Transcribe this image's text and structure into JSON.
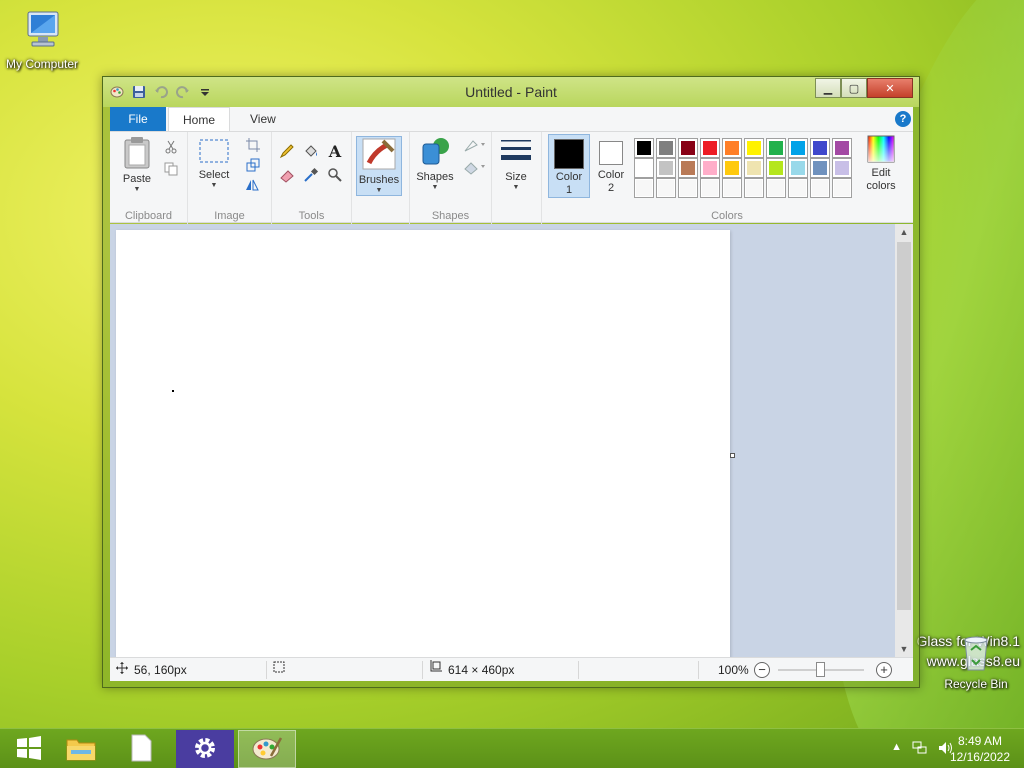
{
  "desktop": {
    "icons": [
      {
        "label": "My Computer",
        "icon": "computer-icon"
      },
      {
        "label": "Recycle Bin",
        "icon": "recycle-bin-icon"
      }
    ],
    "watermark_line1": "Glass for Win8.1",
    "watermark_line2": "www.glass8.eu"
  },
  "window": {
    "title": "Untitled - Paint",
    "controls": {
      "minimize": "minimize-icon",
      "maximize": "maximize-icon",
      "close": "close-icon"
    }
  },
  "tabs": {
    "file": "File",
    "home": "Home",
    "view": "View",
    "help": "?"
  },
  "ribbon": {
    "clipboard": {
      "label": "Clipboard",
      "paste": "Paste"
    },
    "image": {
      "label": "Image",
      "select": "Select"
    },
    "tools": {
      "label": "Tools"
    },
    "brushes": {
      "label": "Brushes"
    },
    "shapes": {
      "label": "Shapes",
      "button": "Shapes"
    },
    "size": {
      "label": "Size"
    },
    "colors": {
      "label": "Colors",
      "color1_line1": "Color",
      "color1_line2": "1",
      "color2_line1": "Color",
      "color2_line2": "2",
      "edit_line1": "Edit",
      "edit_line2": "colors",
      "color1_value": "#000000",
      "color2_value": "#ffffff",
      "palette": [
        "#000000",
        "#7f7f7f",
        "#880015",
        "#ed1c24",
        "#ff7f27",
        "#fff200",
        "#22b14c",
        "#00a2e8",
        "#3f48cc",
        "#a349a4",
        "#ffffff",
        "#c3c3c3",
        "#b97a57",
        "#ffaec9",
        "#ffc90e",
        "#efe4b0",
        "#b5e61d",
        "#99d9ea",
        "#7092be",
        "#c8bfe7",
        "",
        "",
        "",
        "",
        "",
        "",
        "",
        "",
        "",
        ""
      ]
    }
  },
  "status": {
    "cursor_pos": "56, 160px",
    "canvas_size": "614 × 460px",
    "zoom": "100%"
  },
  "taskbar": {
    "time": "8:49 AM",
    "date": "12/16/2022"
  }
}
